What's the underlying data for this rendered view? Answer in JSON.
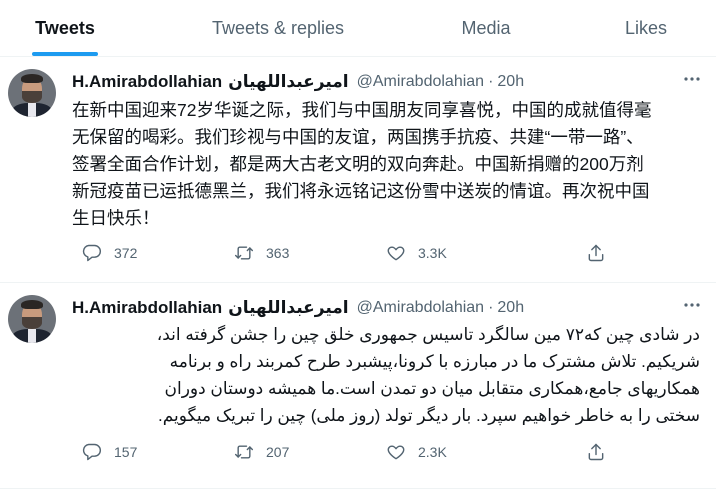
{
  "tabs": [
    {
      "label": "Tweets",
      "active": true
    },
    {
      "label": "Tweets & replies",
      "active": false
    },
    {
      "label": "Media",
      "active": false
    },
    {
      "label": "Likes",
      "active": false
    }
  ],
  "accent_color": "#1d9bf0",
  "tweets": [
    {
      "author_name": "H.Amirabdollahian",
      "author_name_fa": "امیرعبداللهیان",
      "handle": "@Amirabdolahian",
      "separator": "·",
      "time": "20h",
      "lines": [
        "在新中国迎来72岁华诞之际，我们与中国朋友同享喜悦，中国的成就值得毫",
        "无保留的喝彩。我们珍视与中国的友谊，两国携手抗疫、共建“一带一路”、",
        "签署全面合作计划，都是两大古老文明的双向奔赴。中国新捐赠的200万剂",
        "新冠疫苗已运抵德黑兰，我们将永远铭记这份雪中送炭的情谊。再次祝中国",
        "生日快乐！"
      ],
      "replies": "372",
      "retweets": "363",
      "likes": "3.3K"
    },
    {
      "author_name": "H.Amirabdollahian",
      "author_name_fa": "امیرعبداللهیان",
      "handle": "@Amirabdolahian",
      "separator": "·",
      "time": "20h",
      "lines": [
        "در شادی چین که۷۲ مین سالگرد تاسیس جمهوری خلق چین را جشن گرفته اند،",
        "شریکیم. تلاش مشترک ما در مبارزه با کرونا،پیشبرد طرح کمربند راه و برنامه",
        "همکاریهای جامع،همکاری متقابل میان دو تمدن است.ما همیشه دوستان دوران",
        "سختی را به خاطر خواهیم سپرد. بار دیگر تولد (روز ملی) چین را تبریک میگویم."
      ],
      "replies": "157",
      "retweets": "207",
      "likes": "2.3K"
    }
  ],
  "icons": {
    "more": "more-icon",
    "reply": "reply-icon",
    "retweet": "retweet-icon",
    "like": "heart-icon",
    "share": "share-icon"
  }
}
